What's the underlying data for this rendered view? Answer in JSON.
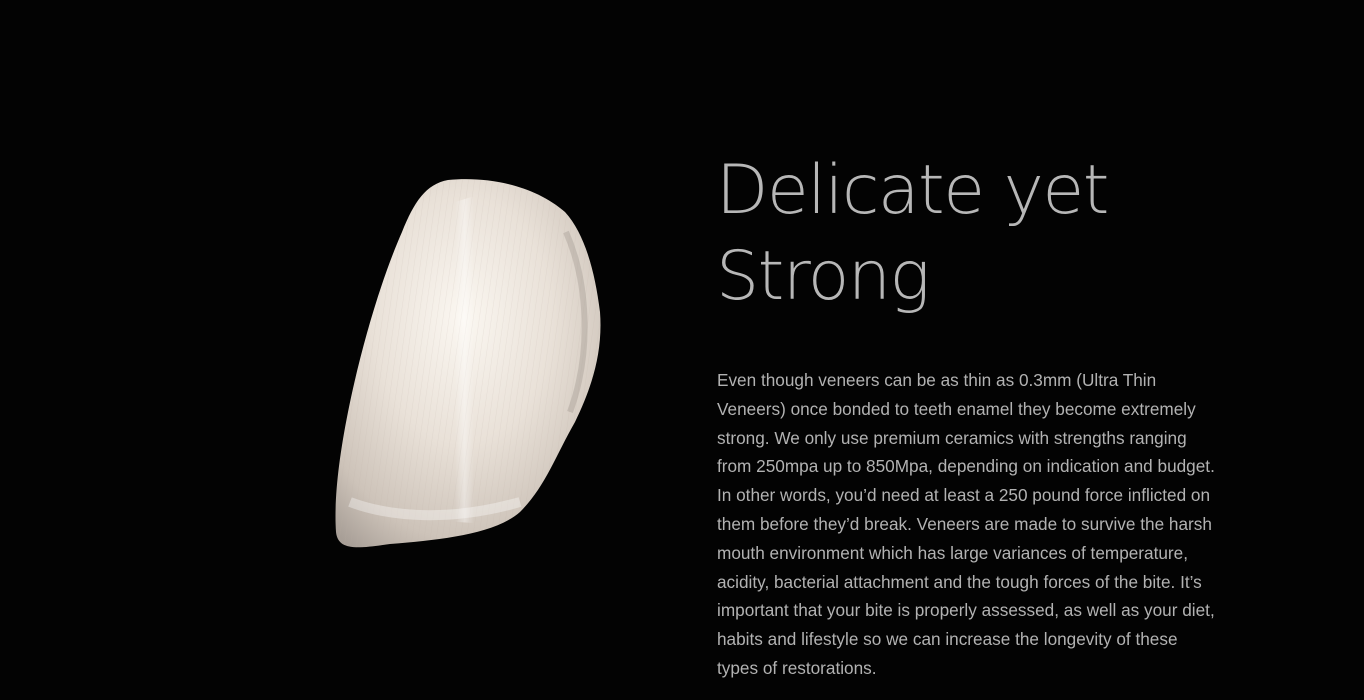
{
  "section": {
    "title_lines": [
      "Delicate yet",
      "Strong"
    ],
    "body_lines": [
      "Even though veneers can be as thin as 0.3mm (Ultra Thin",
      "Veneers) once bonded to teeth enamel they become extremely",
      "strong. We only use premium ceramics with strengths ranging",
      "from 250mpa up to 850Mpa, depending on indication and budget.",
      "In other words, you’d need at least a 250 pound force inflicted on",
      "them before they’d break. Veneers are made to survive the harsh",
      "mouth environment which has large variances of temperature,",
      "acidity, bacterial attachment and the tough forces of the bite. It’s",
      "important that your bite is properly assessed, as well as your diet,",
      "habits and lifestyle so we can increase the longevity of these",
      "types of restorations."
    ]
  },
  "colors": {
    "background": "#030303",
    "title": "#b7b7b7",
    "body": "#b2b2b2"
  }
}
